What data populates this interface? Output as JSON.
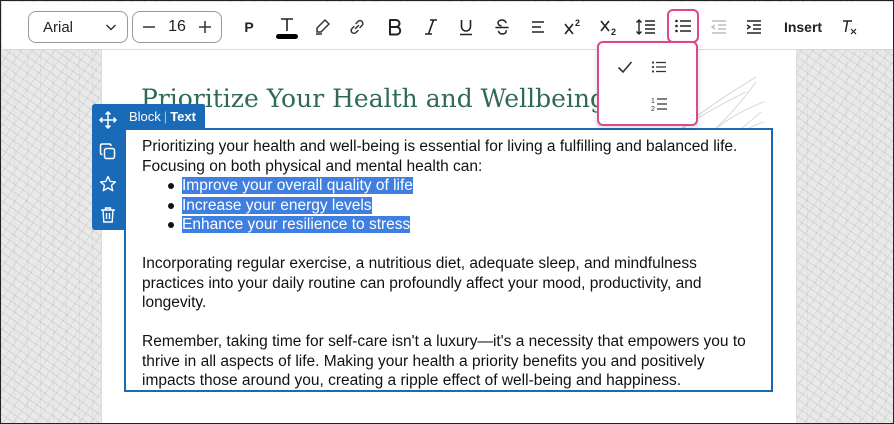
{
  "toolbar": {
    "font_family": "Arial",
    "font_size": "16",
    "paragraph_label": "P",
    "insert_label": "Insert"
  },
  "document": {
    "heading": "Prioritize Your Health and Wellbeing!",
    "intro": "Prioritizing your health and well-being is essential for living a fulfilling and balanced life. Focusing on both physical and mental health can:",
    "bullets": [
      "Improve your overall quality of life ",
      "Increase your energy levels ",
      "Enhance your resilience to stress"
    ],
    "para2": "Incorporating regular exercise, a nutritious diet, adequate sleep, and mindfulness practices into your daily routine can profoundly affect your mood, productivity, and longevity.",
    "para3": "Remember, taking time for self-care isn't a luxury—it's a necessity that empowers you to thrive in all aspects of life. Making your health a priority benefits you and positively impacts those around you, creating a ripple effect of well-being and happiness."
  },
  "block_toolbar": {
    "block_label": "Block",
    "separator": "|",
    "type_label": "Text"
  },
  "colors": {
    "accent_pink": "#e0458e",
    "block_blue": "#1a6bb7",
    "heading_green": "#2f6b52",
    "selection_blue": "#3f7fe0"
  }
}
